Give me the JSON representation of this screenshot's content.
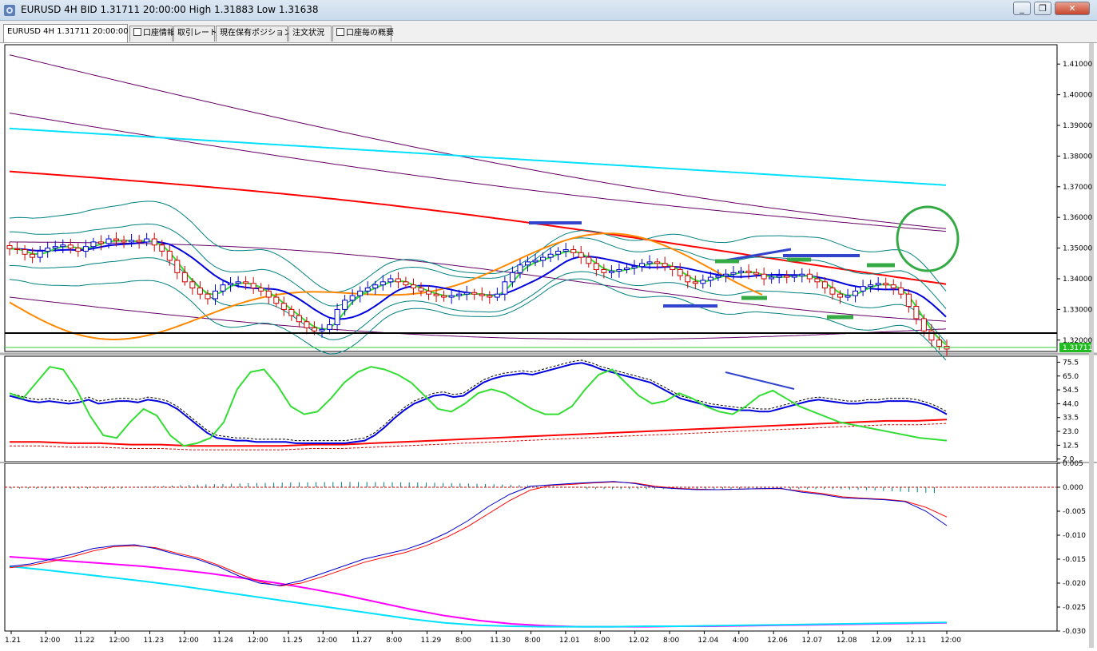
{
  "window": {
    "title": "EURUSD 4H BID 1.31711 20:00:00 High 1.31883 Low 1.31638",
    "buttons": {
      "minimize": "_",
      "restore": "❐",
      "close": "✕"
    }
  },
  "tabs": [
    {
      "label": "EURUSD 4H 1.31711 20:00:00",
      "active": true
    },
    {
      "label": "口座情報",
      "active": false
    },
    {
      "label": "取引レート",
      "active": false
    },
    {
      "label": "現在保有ポジション",
      "active": false
    },
    {
      "label": "注文状況",
      "active": false
    },
    {
      "label": "口座毎の概要",
      "active": false
    }
  ],
  "colors": {
    "background": "#ffffff",
    "bull_candle": "#0000cc",
    "bear_candle": "#cc0000",
    "envelope": "#660066",
    "sma_cyan": "#00e0ff",
    "sma_red": "#ff0000",
    "ma_blue": "#0000dd",
    "ma_green": "#33dd33",
    "band_teal": "#008080",
    "orange": "#ff8800"
  },
  "main_axis": {
    "ticks": [
      "1.41000",
      "1.40000",
      "1.39000",
      "1.38000",
      "1.37000",
      "1.36000",
      "1.35000",
      "1.34000",
      "1.33000",
      "1.32000"
    ],
    "current_price": "1.31711"
  },
  "stoch_axis": {
    "ticks": [
      "75.5",
      "65.0",
      "54.5",
      "44.0",
      "33.5",
      "23.0",
      "12.5",
      "2.0"
    ]
  },
  "macd_axis": {
    "ticks": [
      "0.005",
      "0.000",
      "-0.005",
      "-0.010",
      "-0.015",
      "-0.020",
      "-0.025",
      "-0.030"
    ]
  },
  "time_axis": {
    "labels": [
      "1.21",
      "12:00",
      "11.22",
      "12:00",
      "11.23",
      "12:00",
      "11.24",
      "12:00",
      "11.25",
      "12:00",
      "11.27",
      "8:00",
      "11.29",
      "8:00",
      "11.30",
      "8:00",
      "12.01",
      "8:00",
      "12.02",
      "8:00",
      "12.04",
      "4:00",
      "12.06",
      "12.07",
      "12.08",
      "12.09",
      "12.11",
      "12:00"
    ]
  },
  "chart_data": [
    {
      "type": "candlestick",
      "panel": "main",
      "symbol": "EURUSD",
      "timeframe": "4H",
      "ylim": [
        1.3163,
        1.4163
      ],
      "close_series": [
        1.3498,
        1.3495,
        1.348,
        1.347,
        1.349,
        1.35,
        1.3505,
        1.351,
        1.35,
        1.349,
        1.3505,
        1.352,
        1.3515,
        1.353,
        1.3525,
        1.352,
        1.3525,
        1.352,
        1.353,
        1.351,
        1.349,
        1.346,
        1.342,
        1.339,
        1.337,
        1.335,
        1.3335,
        1.336,
        1.338,
        1.3385,
        1.339,
        1.3385,
        1.337,
        1.336,
        1.334,
        1.332,
        1.33,
        1.328,
        1.326,
        1.324,
        1.323,
        1.3235,
        1.325,
        1.33,
        1.333,
        1.3345,
        1.336,
        1.337,
        1.338,
        1.339,
        1.34,
        1.339,
        1.338,
        1.337,
        1.336,
        1.335,
        1.3345,
        1.334,
        1.3345,
        1.335,
        1.3355,
        1.335,
        1.3345,
        1.334,
        1.335,
        1.339,
        1.342,
        1.3445,
        1.3455,
        1.346,
        1.347,
        1.348,
        1.349,
        1.3495,
        1.3485,
        1.347,
        1.345,
        1.343,
        1.342,
        1.3425,
        1.343,
        1.3435,
        1.344,
        1.345,
        1.3455,
        1.345,
        1.344,
        1.343,
        1.341,
        1.339,
        1.3385,
        1.3395,
        1.3405,
        1.341,
        1.3415,
        1.342,
        1.3425,
        1.342,
        1.3415,
        1.34,
        1.3405,
        1.341,
        1.3405,
        1.341,
        1.3415,
        1.34,
        1.339,
        1.337,
        1.335,
        1.334,
        1.3345,
        1.336,
        1.3375,
        1.338,
        1.3385,
        1.338,
        1.337,
        1.335,
        1.331,
        1.327,
        1.323,
        1.32,
        1.318,
        1.3171
      ],
      "current": 1.31711,
      "high": 1.31883,
      "low": 1.31638
    },
    {
      "type": "line",
      "panel": "stochastic",
      "ylim": [
        0,
        80
      ],
      "series": [
        {
          "role": "main",
          "values": [
            50,
            48,
            46,
            45,
            46,
            45,
            44,
            45,
            47,
            44,
            45,
            46,
            46,
            45,
            47,
            46,
            44,
            40,
            34,
            28,
            22,
            18,
            17,
            16,
            16,
            15,
            15,
            15,
            15,
            14,
            14,
            14,
            14,
            14,
            14,
            15,
            16,
            20,
            26,
            33,
            39,
            44,
            47,
            50,
            51,
            49,
            50,
            55,
            60,
            63,
            65,
            66,
            67,
            66,
            68,
            70,
            72,
            74,
            75,
            73,
            70,
            68,
            66,
            64,
            62,
            60,
            56,
            52,
            48,
            46,
            44,
            42,
            41,
            40,
            39,
            39,
            38,
            38,
            40,
            42,
            44,
            46,
            47,
            46,
            45,
            44,
            44,
            45,
            45,
            46,
            46,
            46,
            45,
            43,
            40,
            36
          ]
        },
        {
          "role": "signal",
          "values": [
            52,
            48,
            60,
            72,
            70,
            55,
            35,
            20,
            18,
            30,
            40,
            35,
            20,
            12,
            14,
            18,
            30,
            55,
            68,
            70,
            58,
            42,
            36,
            38,
            48,
            60,
            68,
            72,
            70,
            66,
            60,
            50,
            40,
            38,
            44,
            52,
            55,
            52,
            46,
            40,
            36,
            36,
            42,
            55,
            66,
            70,
            60,
            50,
            44,
            46,
            52,
            48,
            42,
            38,
            36,
            42,
            50,
            54,
            48,
            42,
            38,
            34,
            30,
            28,
            26,
            24,
            22,
            20,
            18,
            17,
            16
          ]
        },
        {
          "role": "level",
          "values": [
            15,
            15,
            14,
            14,
            13,
            13,
            12,
            12,
            12,
            12,
            13,
            13,
            14,
            15,
            16,
            17,
            18,
            19,
            20,
            21,
            22,
            23,
            24,
            25,
            26,
            27,
            28,
            29,
            30,
            31,
            31,
            32
          ]
        }
      ]
    },
    {
      "type": "line",
      "panel": "macd",
      "ylim": [
        -0.03,
        0.005
      ],
      "series": [
        {
          "role": "macd",
          "values": [
            -0.0165,
            -0.016,
            -0.015,
            -0.014,
            -0.0128,
            -0.0122,
            -0.012,
            -0.0128,
            -0.014,
            -0.015,
            -0.0165,
            -0.0185,
            -0.02,
            -0.0205,
            -0.0195,
            -0.018,
            -0.0165,
            -0.015,
            -0.014,
            -0.013,
            -0.0115,
            -0.0095,
            -0.007,
            -0.004,
            -0.0015,
            0.0002,
            0.0005,
            0.0008,
            0.001,
            0.0012,
            0.0008,
            0.0,
            -0.0003,
            -0.0005,
            -0.0005,
            -0.0004,
            -0.0003,
            -0.0002,
            -0.001,
            -0.0015,
            -0.0022,
            -0.0024,
            -0.0026,
            -0.003,
            -0.005,
            -0.008
          ]
        },
        {
          "role": "signal",
          "values": [
            -0.0168,
            -0.0163,
            -0.0155,
            -0.0145,
            -0.0133,
            -0.0124,
            -0.0122,
            -0.0126,
            -0.0137,
            -0.0147,
            -0.0162,
            -0.018,
            -0.0197,
            -0.0206,
            -0.02,
            -0.0187,
            -0.0172,
            -0.0157,
            -0.0146,
            -0.0136,
            -0.0122,
            -0.0104,
            -0.0082,
            -0.0055,
            -0.0028,
            -0.0006,
            0.0004,
            0.0006,
            0.0009,
            0.0011,
            0.0009,
            0.0002,
            -0.0002,
            -0.0004,
            -0.0005,
            -0.0004,
            -0.0003,
            -0.0003,
            -0.0008,
            -0.0013,
            -0.002,
            -0.0023,
            -0.0025,
            -0.0029,
            -0.0042,
            -0.0062
          ]
        },
        {
          "role": "slow",
          "values": [
            -0.0165,
            -0.0172,
            -0.018,
            -0.0188,
            -0.0196,
            -0.0205,
            -0.0215,
            -0.0225,
            -0.0235,
            -0.0245,
            -0.0255,
            -0.0265,
            -0.0275,
            -0.0283,
            -0.0288,
            -0.029,
            -0.0291,
            -0.0291,
            -0.0291,
            -0.029,
            -0.029,
            -0.0289,
            -0.0288,
            -0.0287,
            -0.0286,
            -0.0285,
            -0.0284,
            -0.0283,
            -0.0282
          ]
        },
        {
          "role": "slow2",
          "values": [
            -0.0145,
            -0.015,
            -0.0155,
            -0.016,
            -0.0165,
            -0.0172,
            -0.018,
            -0.019,
            -0.02,
            -0.0212,
            -0.0225,
            -0.024,
            -0.0255,
            -0.0268,
            -0.0278,
            -0.0285,
            -0.0289,
            -0.0291,
            -0.0291,
            -0.0291,
            -0.029,
            -0.029,
            -0.0289,
            -0.0288,
            -0.0287,
            -0.0286,
            -0.0285,
            -0.0284,
            -0.0283
          ]
        }
      ]
    }
  ]
}
